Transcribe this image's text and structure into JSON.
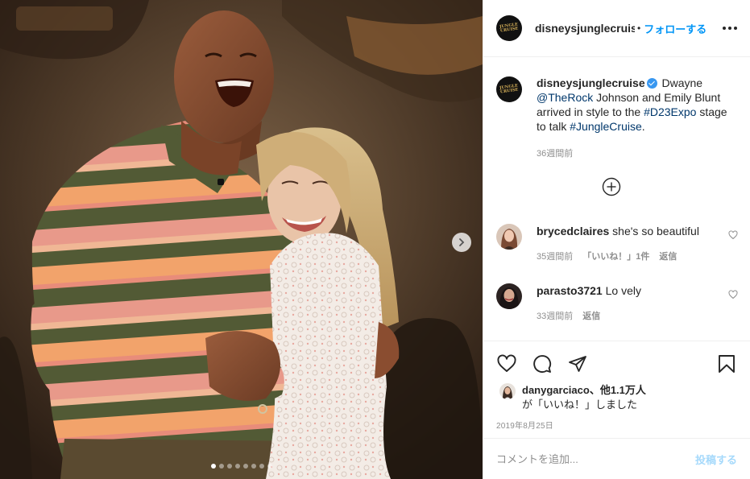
{
  "account": {
    "username": "disneysjunglecruis",
    "full_username": "disneysjunglecruise",
    "separator": "•",
    "follow_label": "フォローする",
    "avatar_text": "JUNGLE CRUISE"
  },
  "caption": {
    "username": "disneysjunglecruise",
    "text_1": " Dwayne ",
    "mention": "@TheRock",
    "text_2": " Johnson and Emily Blunt arrived in style to the ",
    "hashtag_1": "#D23Expo",
    "text_3": " stage to talk ",
    "hashtag_2": "#JungleCruise",
    "text_4": ".",
    "time": "36週間前"
  },
  "comments": [
    {
      "username": "brycedclaires",
      "text": " she's so beautiful",
      "time": "35週間前",
      "likes": "「いいね！」1件",
      "reply": "返信"
    },
    {
      "username": "parasto3721",
      "text": " Lo vely",
      "time": "33週間前",
      "reply": "返信"
    }
  ],
  "likes": {
    "names": "danygarciaco、他1.1万人",
    "suffix": "が「いいね！」しました"
  },
  "date": "2019年8月25日",
  "add_comment": {
    "placeholder": "コメントを追加...",
    "post_label": "投稿する"
  },
  "carousel": {
    "count": 8,
    "active": 1
  },
  "colors": {
    "accent": "#0095f6",
    "link": "#00376b",
    "verified": "#3897f0",
    "muted": "#8e8e8e"
  },
  "icons": [
    "more-icon",
    "verified-icon",
    "load-more-icon",
    "heart-icon",
    "comment-icon",
    "share-icon",
    "bookmark-icon",
    "chevron-right-icon"
  ]
}
